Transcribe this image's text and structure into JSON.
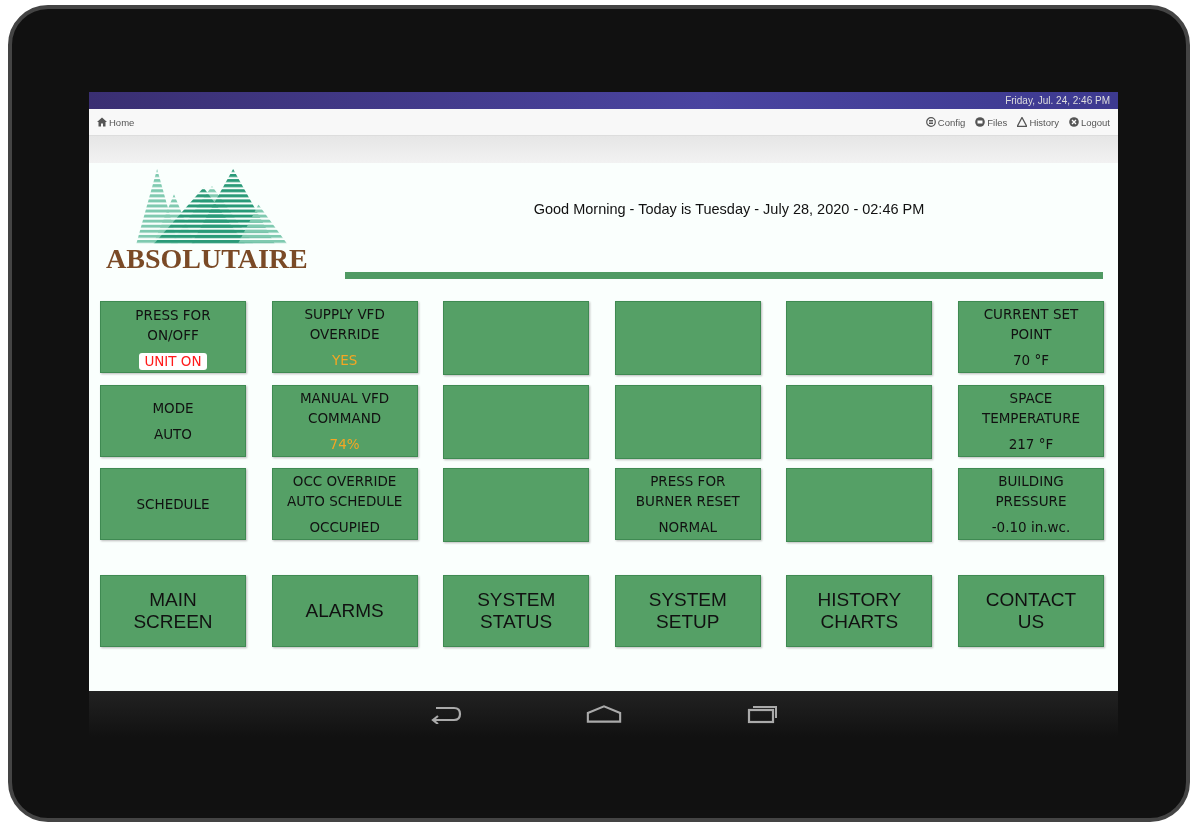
{
  "status_bar": {
    "datetime": "Friday, Jul. 24, 2:46 PM"
  },
  "toolbar": {
    "home": "Home",
    "links": [
      {
        "label": "Config",
        "kind": "config"
      },
      {
        "label": "Files",
        "kind": "files"
      },
      {
        "label": "History",
        "kind": "history"
      },
      {
        "label": "Logout",
        "kind": "logout"
      }
    ]
  },
  "logo": {
    "text": "ABSOLUTAIRE"
  },
  "greeting": "Good Morning - Today is Tuesday - July 28, 2020 - 02:46 PM",
  "tiles": [
    {
      "kind": "control",
      "lines": [
        "PRESS FOR",
        "ON/OFF"
      ],
      "value": "UNIT ON",
      "color": "#ff1a1a"
    },
    {
      "kind": "control",
      "lines": [
        "SUPPLY VFD",
        "OVERRIDE"
      ],
      "value": "YES",
      "color": "#f5a623"
    },
    {
      "kind": "blank"
    },
    {
      "kind": "blank"
    },
    {
      "kind": "blank"
    },
    {
      "kind": "control",
      "lines": [
        "CURRENT SET",
        "POINT"
      ],
      "value": "70 °F",
      "color": "#111111"
    },
    {
      "kind": "control",
      "lines": [
        "MODE"
      ],
      "value": "AUTO",
      "color": "#111111"
    },
    {
      "kind": "control",
      "lines": [
        "MANUAL VFD",
        "COMMAND"
      ],
      "value": "74%",
      "color": "#f5a623"
    },
    {
      "kind": "blank"
    },
    {
      "kind": "blank"
    },
    {
      "kind": "blank"
    },
    {
      "kind": "control",
      "lines": [
        "SPACE",
        "TEMPERATURE"
      ],
      "value": "217 °F",
      "color": "#111111"
    },
    {
      "kind": "control",
      "lines": [
        "SCHEDULE"
      ]
    },
    {
      "kind": "control",
      "lines": [
        "OCC OVERRIDE",
        "AUTO SCHEDULE"
      ],
      "value": "OCCUPIED",
      "color": "#111111"
    },
    {
      "kind": "blank"
    },
    {
      "kind": "control",
      "lines": [
        "PRESS FOR",
        "BURNER RESET"
      ],
      "value": "NORMAL",
      "color": "#111111"
    },
    {
      "kind": "blank"
    },
    {
      "kind": "control",
      "lines": [
        "BUILDING",
        "PRESSURE"
      ],
      "value": "-0.10 in.wc.",
      "color": "#111111"
    }
  ],
  "nav_buttons": [
    [
      "MAIN",
      "SCREEN"
    ],
    [
      "ALARMS"
    ],
    [
      "SYSTEM",
      "STATUS"
    ],
    [
      "SYSTEM",
      "SETUP"
    ],
    [
      "HISTORY",
      "CHARTS"
    ],
    [
      "CONTACT",
      "US"
    ]
  ]
}
